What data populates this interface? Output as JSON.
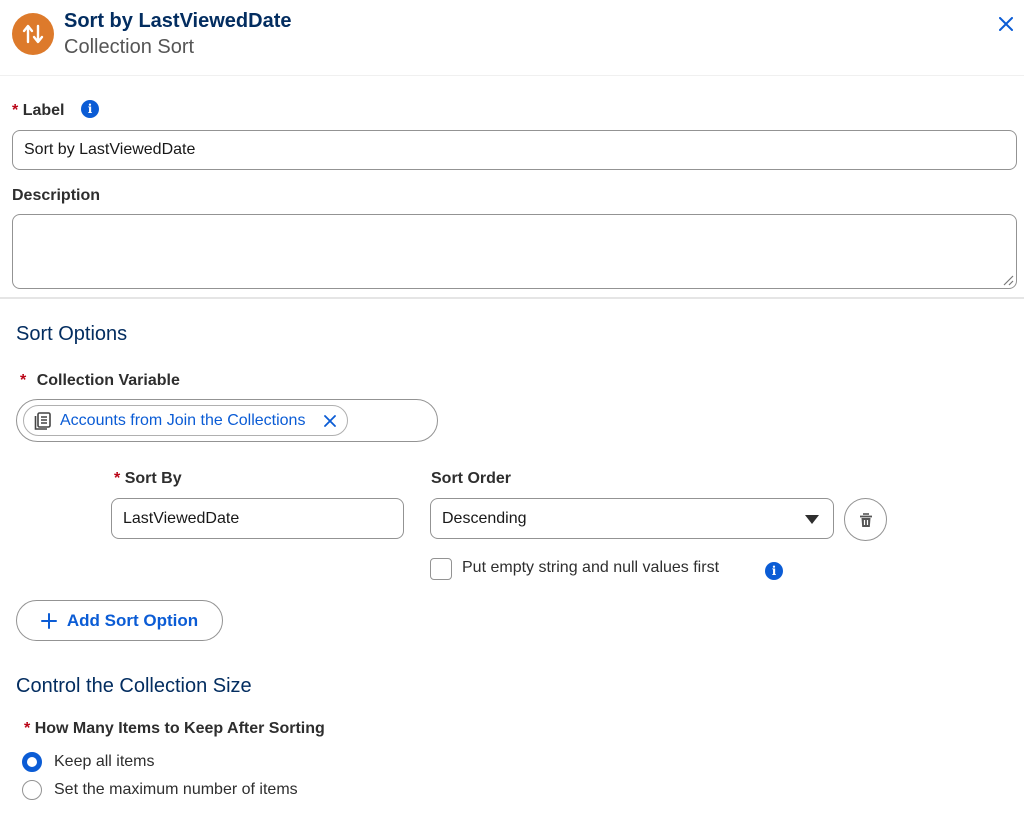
{
  "header": {
    "title": "Sort by LastViewedDate",
    "subtitle": "Collection Sort",
    "icon": "sort-arrows-icon",
    "icon_color": "#dd7a2b"
  },
  "label_field": {
    "required_marker": "*",
    "label": "Label",
    "value": "Sort by LastViewedDate"
  },
  "description_field": {
    "label": "Description",
    "value": ""
  },
  "sort_options": {
    "section_title": "Sort Options",
    "collection_variable": {
      "required_marker": "*",
      "label": "Collection Variable",
      "pill_label": "Accounts from Join the Collections",
      "pill_icon": "record-collection-icon"
    },
    "sort_by": {
      "required_marker": "*",
      "label": "Sort By",
      "value": "LastViewedDate"
    },
    "sort_order": {
      "label": "Sort Order",
      "selected": "Descending"
    },
    "null_first": {
      "label": "Put empty string and null values first",
      "checked": false
    },
    "add_button": "Add Sort Option"
  },
  "collection_size": {
    "section_title": "Control the Collection Size",
    "required_marker": "*",
    "question": "How Many Items to Keep After Sorting",
    "options": [
      {
        "label": "Keep all items",
        "selected": true
      },
      {
        "label": "Set the maximum number of items",
        "selected": false
      }
    ]
  },
  "colors": {
    "brand_blue": "#0b5cd5",
    "heading_navy": "#032d60",
    "required_red": "#ba0517"
  }
}
